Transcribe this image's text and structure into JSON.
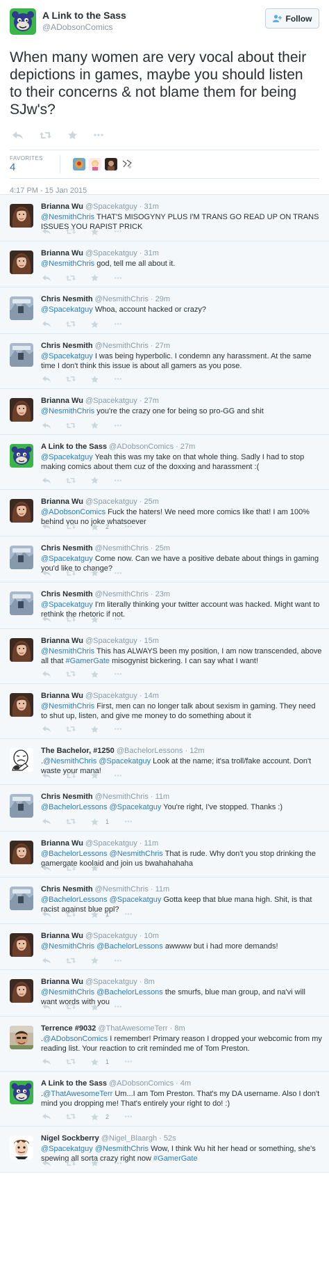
{
  "main_tweet": {
    "author_name": "A Link to the Sass",
    "author_handle": "@ADobsonComics",
    "follow_label": "Follow",
    "text": "When many women are very vocal about their depictions in games, maybe you should listen to their concerns & not blame them for being SJw's?",
    "favorites_label": "FAVORITES",
    "favorites_count": "4",
    "timestamp": "4:17 PM - 15 Jan 2015"
  },
  "replies": [
    {
      "avatar": "brianna",
      "name": "Brianna Wu",
      "handle": "@Spacekatguy",
      "time": "· 31m",
      "text": [
        {
          "mention": "@NesmithChris"
        },
        {
          "plain": " THAT'S MISOGYNY PLUS I'M TRANS GO READ UP ON TRANS ISSUES YOU RAPIST PRICK"
        }
      ],
      "favorites": ""
    },
    {
      "avatar": "brianna",
      "name": "Brianna Wu",
      "handle": "@Spacekatguy",
      "time": "· 31m",
      "text": [
        {
          "mention": "@NesmithChris"
        },
        {
          "plain": " god, tell me all about it."
        }
      ],
      "favorites": ""
    },
    {
      "avatar": "chris",
      "name": "Chris Nesmith",
      "handle": "@NesmithChris",
      "time": "· 29m",
      "text": [
        {
          "mention": "@Spacekatguy"
        },
        {
          "plain": " Whoa, account hacked or crazy?"
        }
      ],
      "favorites": ""
    },
    {
      "avatar": "chris",
      "name": "Chris Nesmith",
      "handle": "@NesmithChris",
      "time": "· 27m",
      "text": [
        {
          "mention": "@Spacekatguy"
        },
        {
          "plain": " I was being hyperbolic. I condemn any harassment. At the same time I don't think this issue is about all gamers as you pose."
        }
      ],
      "favorites": ""
    },
    {
      "avatar": "brianna",
      "name": "Brianna Wu",
      "handle": "@Spacekatguy",
      "time": "· 27m",
      "text": [
        {
          "mention": "@NesmithChris"
        },
        {
          "plain": " you're the crazy one for being so pro-GG and shit"
        }
      ],
      "favorites": ""
    },
    {
      "avatar": "link",
      "name": "A Link to the Sass",
      "handle": "@ADobsonComics",
      "time": "· 27m",
      "text": [
        {
          "mention": "@Spacekatguy"
        },
        {
          "plain": " Yeah this was my take on that whole thing. Sadly I had to stop making comics about them cuz of the doxxing and harassment :("
        }
      ],
      "favorites": ""
    },
    {
      "avatar": "brianna",
      "name": "Brianna Wu",
      "handle": "@Spacekatguy",
      "time": "· 25m",
      "text": [
        {
          "mention": "@ADobsonComics"
        },
        {
          "plain": " Fuck the haters! We need more comics like that! I am 100% behind you no joke whatsoever"
        }
      ],
      "favorites": "2"
    },
    {
      "avatar": "chris",
      "name": "Chris Nesmith",
      "handle": "@NesmithChris",
      "time": "· 25m",
      "text": [
        {
          "mention": "@Spacekatguy"
        },
        {
          "plain": " Come now. Can we have a positive debate about things in gaming you'd like to change?"
        }
      ],
      "favorites": ""
    },
    {
      "avatar": "chris",
      "name": "Chris Nesmith",
      "handle": "@NesmithChris",
      "time": "· 23m",
      "text": [
        {
          "mention": "@Spacekatguy"
        },
        {
          "plain": " I'm literally thinking your twitter account was hacked. Might want to rethink the rhetoric if not."
        }
      ],
      "favorites": ""
    },
    {
      "avatar": "brianna",
      "name": "Brianna Wu",
      "handle": "@Spacekatguy",
      "time": "· 15m",
      "text": [
        {
          "mention": "@NesmithChris"
        },
        {
          "plain": " This has ALWAYS been my position, I am now transcended, above all that "
        },
        {
          "hashtag": "#GamerGate"
        },
        {
          "plain": " misogynist bickering. I can say what I want!"
        }
      ],
      "favorites": ""
    },
    {
      "avatar": "brianna",
      "name": "Brianna Wu",
      "handle": "@Spacekatguy",
      "time": "· 14m",
      "text": [
        {
          "mention": "@NesmithChris"
        },
        {
          "plain": " First, men can no longer talk about sexism in gaming. They need to shut up, listen, and give me money to do something about it"
        }
      ],
      "favorites": ""
    },
    {
      "avatar": "bachelor",
      "name": "The Bachelor, #1250",
      "handle": "@BachelorLessons",
      "time": "· 12m",
      "text": [
        {
          "plain": "."
        },
        {
          "mention": "@NesmithChris"
        },
        {
          "plain": " "
        },
        {
          "mention": "@Spacekatguy"
        },
        {
          "plain": " Look at the name; it'sa troll/fake account. Don't waste your mana!"
        }
      ],
      "favorites": ""
    },
    {
      "avatar": "chris",
      "name": "Chris Nesmith",
      "handle": "@NesmithChris",
      "time": "· 11m",
      "text": [
        {
          "mention": "@BachelorLessons"
        },
        {
          "plain": " "
        },
        {
          "mention": "@Spacekatguy"
        },
        {
          "plain": " You're right, I've stopped. Thanks :)"
        }
      ],
      "favorites": "1"
    },
    {
      "avatar": "brianna",
      "name": "Brianna Wu",
      "handle": "@Spacekatguy",
      "time": "· 11m",
      "text": [
        {
          "mention": "@BachelorLessons"
        },
        {
          "plain": " "
        },
        {
          "mention": "@NesmithChris"
        },
        {
          "plain": " That is rude. Why don't you stop drinking the gamergate koolaid and join us bwahahahaha"
        }
      ],
      "favorites": ""
    },
    {
      "avatar": "chris",
      "name": "Chris Nesmith",
      "handle": "@NesmithChris",
      "time": "· 11m",
      "text": [
        {
          "mention": "@BachelorLessons"
        },
        {
          "plain": " "
        },
        {
          "mention": "@Spacekatguy"
        },
        {
          "plain": " Gotta keep that blue mana high. Shit, is that racist against blue ppl?"
        }
      ],
      "favorites": "1"
    },
    {
      "avatar": "brianna",
      "name": "Brianna Wu",
      "handle": "@Spacekatguy",
      "time": "· 10m",
      "text": [
        {
          "mention": "@NesmithChris"
        },
        {
          "plain": " "
        },
        {
          "mention": "@BachelorLessons"
        },
        {
          "plain": " awwww but i had more demands!"
        }
      ],
      "favorites": ""
    },
    {
      "avatar": "brianna",
      "name": "Brianna Wu",
      "handle": "@Spacekatguy",
      "time": "· 8m",
      "text": [
        {
          "mention": "@NesmithChris"
        },
        {
          "plain": " "
        },
        {
          "mention": "@BachelorLessons"
        },
        {
          "plain": " the smurfs, blue man group, and na'vi will want words with you"
        }
      ],
      "favorites": ""
    },
    {
      "avatar": "terrence",
      "name": "Terrence #9032",
      "handle": "@ThatAwesomeTerr",
      "time": "· 8m",
      "text": [
        {
          "plain": "."
        },
        {
          "mention": "@ADobsonComics"
        },
        {
          "plain": " I remember! Primary reason I dropped your webcomic from my reading list. Your reaction to crit reminded me of Tom Preston."
        }
      ],
      "favorites": "1"
    },
    {
      "avatar": "link",
      "name": "A Link to the Sass",
      "handle": "@ADobsonComics",
      "time": "· 4m",
      "text": [
        {
          "plain": "."
        },
        {
          "mention": "@ThatAwesomeTerr"
        },
        {
          "plain": " Um...I am Tom Preston. That's my DA username. Also I don't mind you dropping me! That's entirely your right to do! :)"
        }
      ],
      "favorites": "2"
    },
    {
      "avatar": "nigel",
      "name": "Nigel Sockberry",
      "handle": "@Nigel_Blaargh",
      "time": "· 52s",
      "text": [
        {
          "mention": "@Spacekatguy"
        },
        {
          "plain": " "
        },
        {
          "mention": "@NesmithChris"
        },
        {
          "plain": " Wow, I think Wu hit her head or something, she's spewing all sorta crazy right now "
        },
        {
          "hashtag": "#GamerGate"
        }
      ],
      "favorites": ""
    }
  ],
  "colors": {
    "link_blue": "#2b7bb9",
    "secondary_gray": "#8899a6",
    "reply_background": "#f5f8fa",
    "divider": "#e1e8ed"
  },
  "icons": [
    "reply-icon",
    "retweet-icon",
    "favorite-star-icon",
    "more-icon",
    "follow-person-icon"
  ]
}
